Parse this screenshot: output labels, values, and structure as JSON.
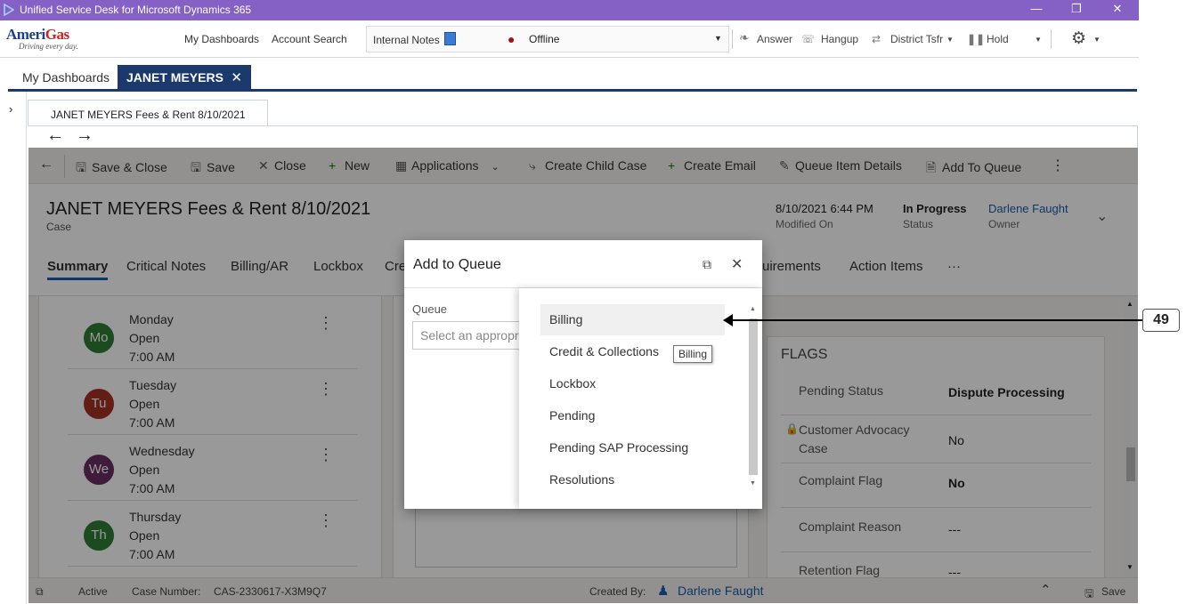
{
  "window": {
    "title": "Unified Service Desk for Microsoft Dynamics 365",
    "controls": [
      "—",
      "❐",
      "✕"
    ]
  },
  "brand": {
    "name_main": "Ameri",
    "name_accent": "Gas",
    "tagline": "Driving every day."
  },
  "toolbar": {
    "my_dashboards": "My Dashboards",
    "account_search": "Account Search",
    "session_notes": "Internal Notes",
    "presence": "Offline",
    "answer": "Answer",
    "hangup": "Hangup",
    "district_tsfr": "District Tsfr",
    "hold": "Hold"
  },
  "tabs": {
    "dashboards": "My Dashboards",
    "active": "JANET MEYERS",
    "close": "✕"
  },
  "inner_tab": {
    "label": "JANET MEYERS  Fees & Rent 8/10/2021"
  },
  "commands": {
    "save_close": "Save & Close",
    "save": "Save",
    "close": "Close",
    "new": "New",
    "applications": "Applications",
    "create_child_case": "Create Child Case",
    "create_email": "Create Email",
    "queue_item_details": "Queue Item Details",
    "add_to_queue": "Add To Queue"
  },
  "record": {
    "title": "JANET MEYERS  Fees & Rent 8/10/2021",
    "type": "Case",
    "modified_value": "8/10/2021 6:44 PM",
    "modified_label": "Modified On",
    "status_value": "In Progress",
    "status_label": "Status",
    "owner_value": "Darlene Faught",
    "owner_label": "Owner"
  },
  "form_tabs": [
    "Summary",
    "Critical Notes",
    "Billing/AR",
    "Lockbox",
    "Cre",
    "uirements",
    "Action Items",
    "···"
  ],
  "hours": [
    {
      "abbr": "Mo",
      "day": "Monday",
      "status": "Open",
      "time": "7:00 AM",
      "color": "#2e7d32"
    },
    {
      "abbr": "Tu",
      "day": "Tuesday",
      "status": "Open",
      "time": "7:00 AM",
      "color": "#a33224"
    },
    {
      "abbr": "We",
      "day": "Wednesday",
      "status": "Open",
      "time": "7:00 AM",
      "color": "#6b2f64"
    },
    {
      "abbr": "Th",
      "day": "Thursday",
      "status": "Open",
      "time": "7:00 AM",
      "color": "#2e7d32"
    }
  ],
  "flags": {
    "heading": "FLAGS",
    "pending_status_label": "Pending Status",
    "pending_status_value": "Dispute Processing",
    "advocacy_label_1": "Customer Advocacy",
    "advocacy_label_2": "Case",
    "advocacy_value": "No",
    "complaint_flag_label": "Complaint Flag",
    "complaint_flag_value": "No",
    "complaint_reason_label": "Complaint Reason",
    "complaint_reason_value": "---",
    "retention_flag_label": "Retention Flag",
    "retention_flag_value": "---"
  },
  "footer": {
    "state": "Active",
    "case_number_label": "Case Number:",
    "case_number": "CAS-2330617-X3M9Q7",
    "created_by_label": "Created By:",
    "created_by": "Darlene Faught",
    "save": "Save"
  },
  "dialog": {
    "title": "Add to Queue",
    "field_label": "Queue",
    "placeholder": "Select an appropri",
    "options": [
      "Billing",
      "Credit & Collections",
      "Lockbox",
      "Pending",
      "Pending SAP Processing",
      "Resolutions"
    ],
    "highlighted": "Billing",
    "tooltip": "Billing"
  },
  "annotation": {
    "label": "49"
  }
}
